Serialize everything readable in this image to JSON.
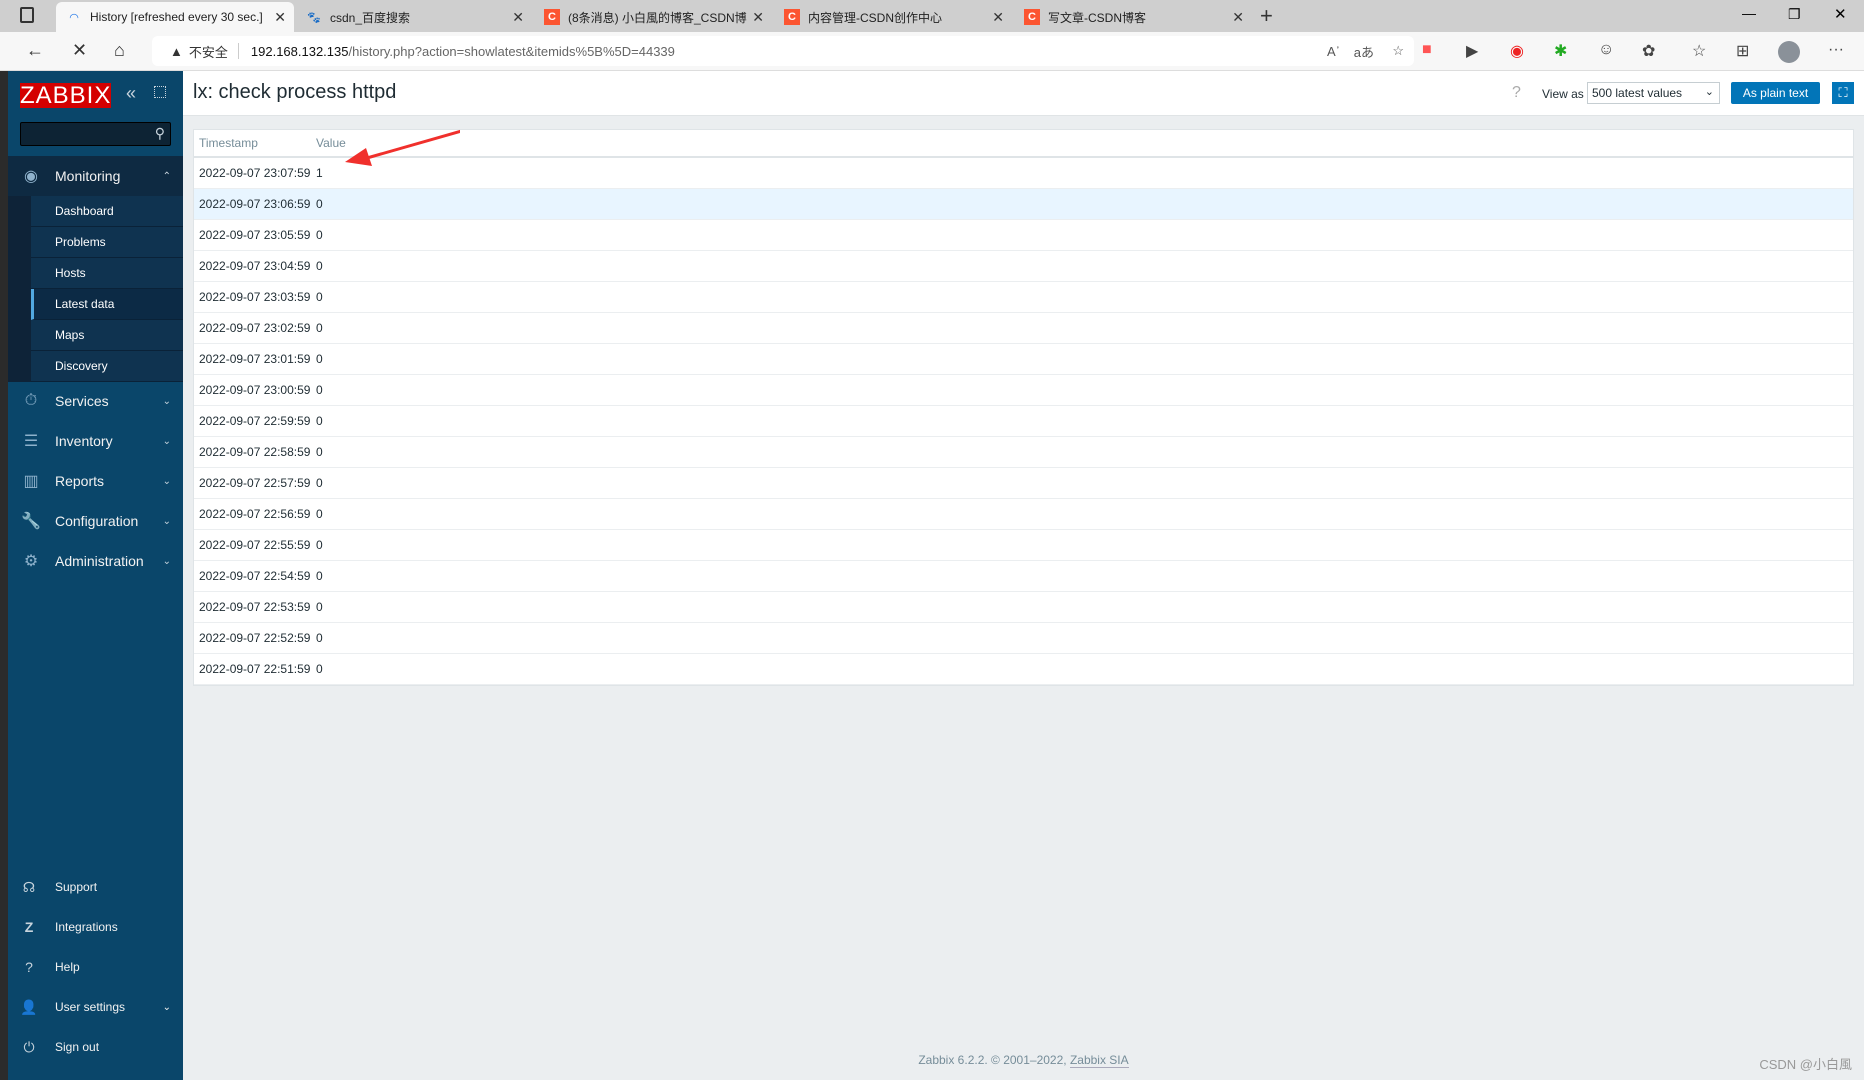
{
  "browser": {
    "tabs": [
      {
        "label": "History [refreshed every 30 sec.]",
        "active": true
      },
      {
        "label": "csdn_百度搜索"
      },
      {
        "label": "(8条消息) 小白風的博客_CSDN博"
      },
      {
        "label": "内容管理-CSDN创作中心"
      },
      {
        "label": "写文章-CSDN博客"
      }
    ],
    "security_label": "不安全",
    "url_host": "192.168.132.135",
    "url_path": "/history.php?action=showlatest&itemids%5B%5D=44339"
  },
  "sidebar": {
    "logo": "ZABBIX",
    "search_placeholder": "",
    "monitoring": {
      "label": "Monitoring",
      "items": [
        "Dashboard",
        "Problems",
        "Hosts",
        "Latest data",
        "Maps",
        "Discovery"
      ],
      "selected": "Latest data"
    },
    "menus": [
      "Services",
      "Inventory",
      "Reports",
      "Configuration",
      "Administration"
    ],
    "bottom": [
      "Support",
      "Integrations",
      "Help",
      "User settings",
      "Sign out"
    ]
  },
  "header": {
    "title": "lx: check process httpd",
    "help": "?",
    "view_as_label": "View as",
    "view_as_value": "500 latest values",
    "plain_text_button": "As plain text"
  },
  "table": {
    "columns": [
      "Timestamp",
      "Value"
    ],
    "rows": [
      [
        "2022-09-07 23:07:59",
        "1"
      ],
      [
        "2022-09-07 23:06:59",
        "0"
      ],
      [
        "2022-09-07 23:05:59",
        "0"
      ],
      [
        "2022-09-07 23:04:59",
        "0"
      ],
      [
        "2022-09-07 23:03:59",
        "0"
      ],
      [
        "2022-09-07 23:02:59",
        "0"
      ],
      [
        "2022-09-07 23:01:59",
        "0"
      ],
      [
        "2022-09-07 23:00:59",
        "0"
      ],
      [
        "2022-09-07 22:59:59",
        "0"
      ],
      [
        "2022-09-07 22:58:59",
        "0"
      ],
      [
        "2022-09-07 22:57:59",
        "0"
      ],
      [
        "2022-09-07 22:56:59",
        "0"
      ],
      [
        "2022-09-07 22:55:59",
        "0"
      ],
      [
        "2022-09-07 22:54:59",
        "0"
      ],
      [
        "2022-09-07 22:53:59",
        "0"
      ],
      [
        "2022-09-07 22:52:59",
        "0"
      ],
      [
        "2022-09-07 22:51:59",
        "0"
      ]
    ]
  },
  "footer": {
    "text": "Zabbix 6.2.2. © 2001–2022, ",
    "link": "Zabbix SIA"
  },
  "watermark": "CSDN @小白風",
  "colors": {
    "sidebar": "#0a466a",
    "accent": "#0275b8",
    "logo": "#d40000",
    "annotation_arrow": "#f0302c"
  }
}
